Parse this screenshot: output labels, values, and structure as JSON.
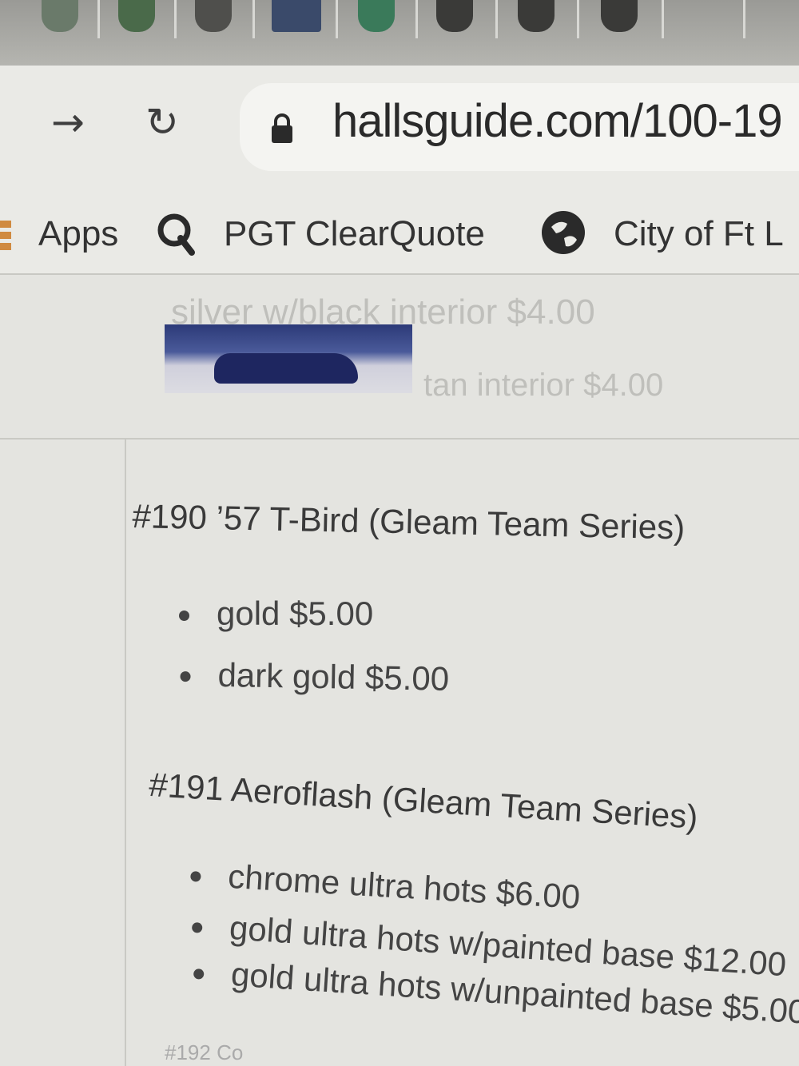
{
  "browser": {
    "url": "hallsguide.com/100-19",
    "bookmarks": {
      "apps_label": "Apps",
      "items": [
        {
          "label": "PGT ClearQuote",
          "icon": "search-q-icon"
        },
        {
          "label": "City of Ft L",
          "icon": "globe-icon"
        }
      ]
    }
  },
  "page": {
    "faded_items": [
      "silver w/black interior $4.00",
      "tan interior $4.00"
    ],
    "sections": [
      {
        "heading": "#190 ’57 T-Bird (Gleam Team Series)",
        "items": [
          "gold $5.00",
          "dark gold $5.00"
        ]
      },
      {
        "heading": "#191 Aeroflash (Gleam Team Series)",
        "items": [
          "chrome ultra hots $6.00",
          "gold ultra hots w/painted base $12.00",
          "gold ultra hots w/unpainted base $5.00"
        ]
      }
    ],
    "next_heading_partial": "#192 Co"
  }
}
